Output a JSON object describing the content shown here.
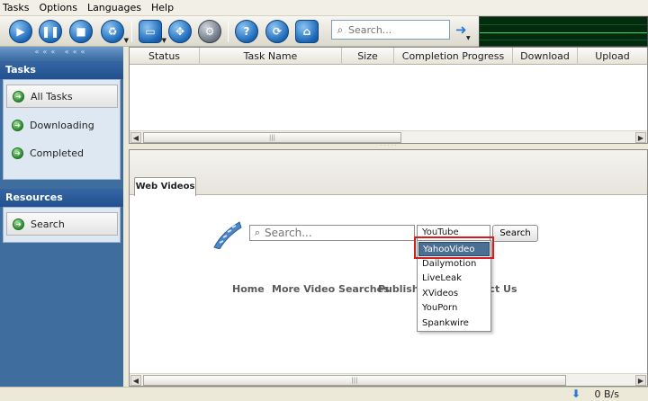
{
  "menu": [
    "Tasks",
    "Options",
    "Languages",
    "Help"
  ],
  "toolbar": {
    "search_placeholder": "Search..."
  },
  "sidebar": {
    "tasks_title": "Tasks",
    "tasks_items": [
      "All Tasks",
      "Downloading",
      "Completed"
    ],
    "resources_title": "Resources",
    "resources_items": [
      "Search"
    ]
  },
  "table": {
    "columns": [
      "Status",
      "Task Name",
      "Size",
      "Completion Progress",
      "Download",
      "Upload"
    ]
  },
  "webvideos": {
    "tab_label": "Web Videos",
    "search_placeholder": "Search...",
    "selected_site": "YouTube",
    "search_button": "Search",
    "dropdown_options": [
      "YahooVideo",
      "Dailymotion",
      "LiveLeak",
      "XVideos",
      "YouPorn",
      "Spankwire"
    ],
    "highlighted_option": "YahooVideo",
    "links": [
      "Home",
      "More Video Searches",
      "Publish V",
      "act Us"
    ]
  },
  "status": {
    "download_speed": "0 B/s"
  }
}
